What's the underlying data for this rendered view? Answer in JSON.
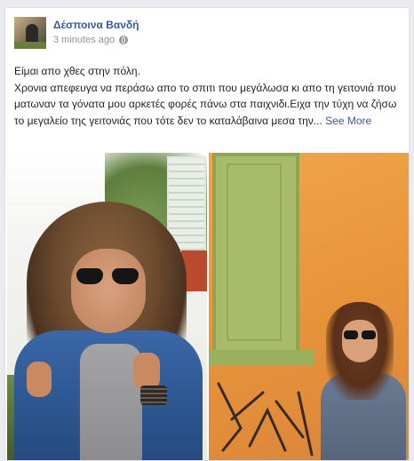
{
  "post": {
    "author": "Δέσποινα Βανδή",
    "timestamp": "3 minutes ago",
    "privacy_icon": "globe-icon",
    "text_lines": [
      "Είμαι απο χθες στην πόλη.",
      "Χρονια απεφευγα να περάσω απο το σπιτι που μεγάλωσα κι απο τη γειτονιά που ματωναν τα γόνατα μου αρκετές φορές πάνω στα παιχνιδι.Ειχα την τύχη να ζήσω το μεγαλείο της γειτονιάς που τότε δεν το καταλάβαινα μεσα την..."
    ],
    "see_more": "See More"
  },
  "colors": {
    "link": "#3b5998",
    "text": "#1d2129",
    "meta": "#90949c"
  }
}
